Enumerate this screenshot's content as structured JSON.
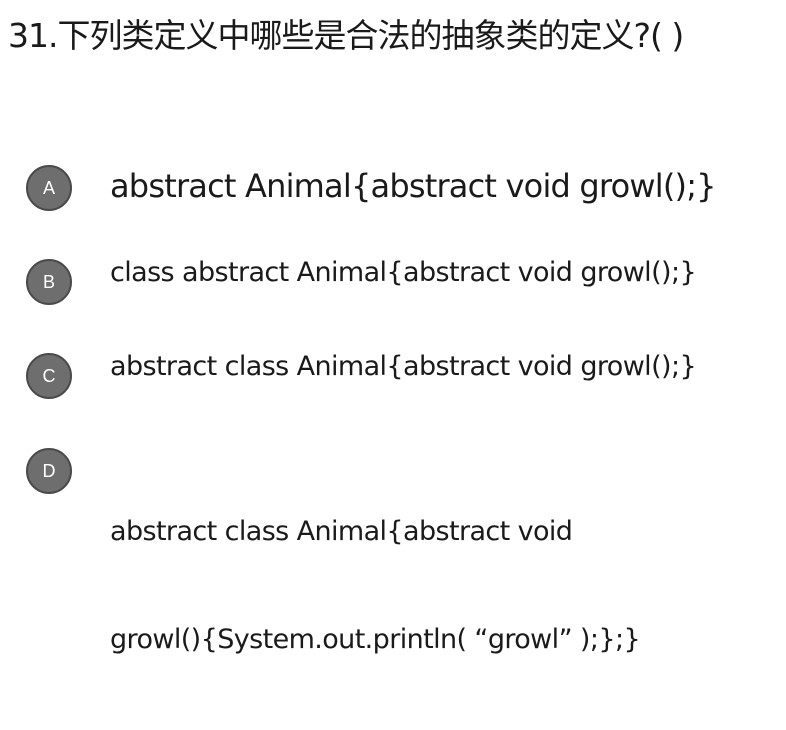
{
  "question": "31.下列类定义中哪些是合法的抽象类的定义?( )",
  "options": [
    {
      "letter": "A",
      "text": "abstract Animal{abstract void growl();}"
    },
    {
      "letter": "B",
      "text": "class abstract Animal{abstract void growl();}"
    },
    {
      "letter": "C",
      "text": "abstract class Animal{abstract void growl();}"
    },
    {
      "letter": "D",
      "line1": "abstract class Animal{abstract void",
      "line2": "growl(){System.out.println( “growl” );};}"
    }
  ],
  "colors": {
    "badge": "#6e6e6e",
    "badge_border": "#4a4a4a",
    "text": "#1a1a1a",
    "background": "#ffffff"
  }
}
